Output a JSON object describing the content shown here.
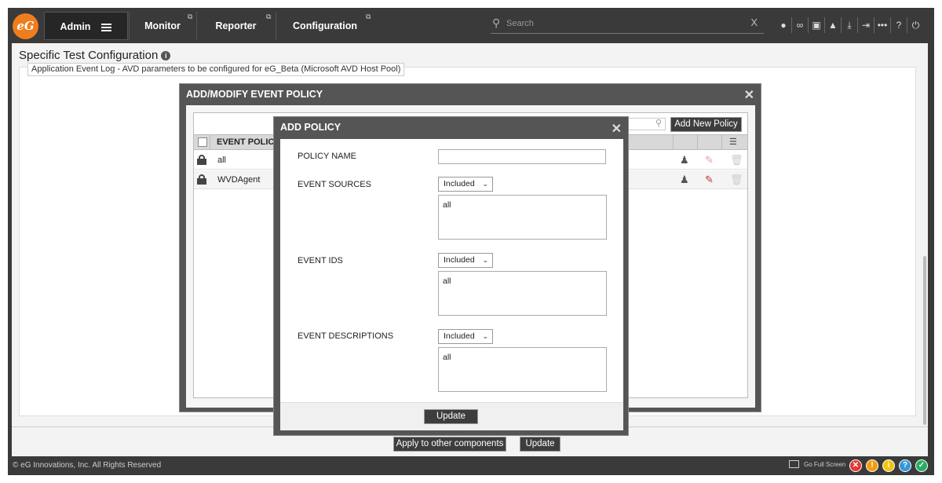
{
  "topbar": {
    "logo_text": "eG",
    "tabs": [
      {
        "label": "Admin",
        "active": true
      },
      {
        "label": "Monitor"
      },
      {
        "label": "Reporter"
      },
      {
        "label": "Configuration"
      }
    ],
    "search_placeholder": "Search",
    "search_clear": "X",
    "icons": [
      "user-icon",
      "link-icon",
      "layout-icon",
      "bell-icon",
      "download-icon",
      "sign-in-icon",
      "more-icon",
      "help-icon",
      "power-icon"
    ]
  },
  "page": {
    "title": "Specific Test Configuration",
    "info_glyph": "i",
    "param_label": "Application Event Log - AVD parameters to be configured for eG_Beta (Microsoft AVD Host Pool)",
    "apply_button": "Apply to other components",
    "update_button": "Update"
  },
  "event_policy_modal": {
    "title": "ADD/MODIFY EVENT POLICY",
    "close": "✕",
    "add_new_button": "Add New Policy",
    "column_header": "EVENT POLICY",
    "rows": [
      {
        "name": "all"
      },
      {
        "name": "WVDAgent"
      }
    ]
  },
  "add_policy_modal": {
    "title": "ADD POLICY",
    "close": "✕",
    "policy_name_label": "POLICY NAME",
    "policy_name_value": "",
    "event_sources_label": "EVENT SOURCES",
    "event_sources_select": "Included",
    "event_sources_value": "all",
    "event_ids_label": "EVENT IDS",
    "event_ids_select": "Included",
    "event_ids_value": "all",
    "event_descriptions_label": "EVENT DESCRIPTIONS",
    "event_descriptions_select": "Included",
    "event_descriptions_value": "all",
    "update_button": "Update"
  },
  "footer": {
    "copyright": "© eG Innovations, Inc. All Rights Reserved",
    "go_full_screen": "Go Full Screen",
    "status_icons": [
      {
        "name": "critical-status-icon",
        "glyph": "✕",
        "color": "#e53935"
      },
      {
        "name": "major-status-icon",
        "glyph": "!",
        "color": "#f39c12"
      },
      {
        "name": "minor-status-icon",
        "glyph": "i",
        "color": "#f1c40f"
      },
      {
        "name": "unknown-status-icon",
        "glyph": "?",
        "color": "#3498db"
      },
      {
        "name": "normal-status-icon",
        "glyph": "✓",
        "color": "#27ae60"
      }
    ]
  }
}
